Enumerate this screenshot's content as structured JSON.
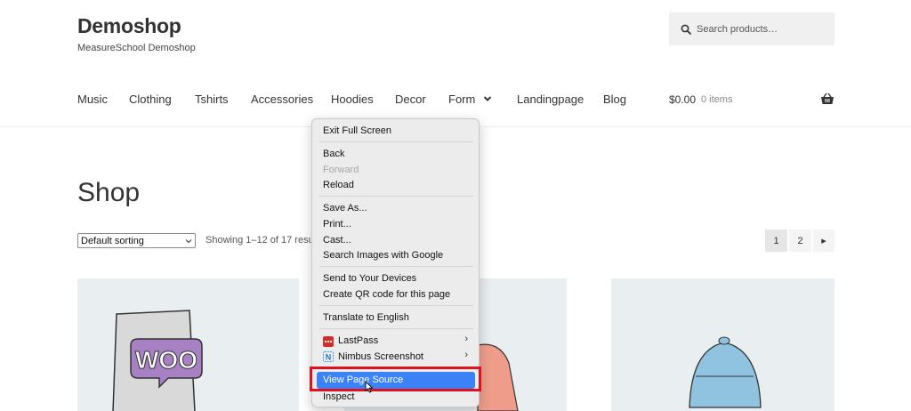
{
  "site": {
    "title": "Demoshop",
    "tagline": "MeasureSchool Demoshop"
  },
  "search": {
    "placeholder": "Search products…",
    "icon": "search-icon"
  },
  "nav": {
    "items": [
      "Music",
      "Clothing",
      "Tshirts",
      "Accessories",
      "Hoodies",
      "Decor",
      "Form",
      "Landingpage",
      "Blog"
    ]
  },
  "cart": {
    "total": "$0.00",
    "count": "0 items",
    "icon": "basket-icon"
  },
  "shop": {
    "title": "Shop",
    "sort_selected": "Default sorting",
    "result_count": "Showing 1–12 of 17 results",
    "pages": [
      "1",
      "2"
    ],
    "next_glyph": "▸"
  },
  "context_menu": {
    "exit_full_screen": "Exit Full Screen",
    "back": "Back",
    "forward": "Forward",
    "reload": "Reload",
    "save_as": "Save As...",
    "print": "Print...",
    "cast": "Cast...",
    "search_images": "Search Images with Google",
    "send_devices": "Send to Your Devices",
    "qr_code": "Create QR code for this page",
    "translate": "Translate to English",
    "lastpass": "LastPass",
    "nimbus": "Nimbus Screenshot",
    "view_source": "View Page Source",
    "inspect": "Inspect",
    "submenu_arrow": "›"
  },
  "colors": {
    "highlight": "#3b82f6",
    "annotation_box": "#e0101e",
    "product_bg": "#e9eef0"
  }
}
